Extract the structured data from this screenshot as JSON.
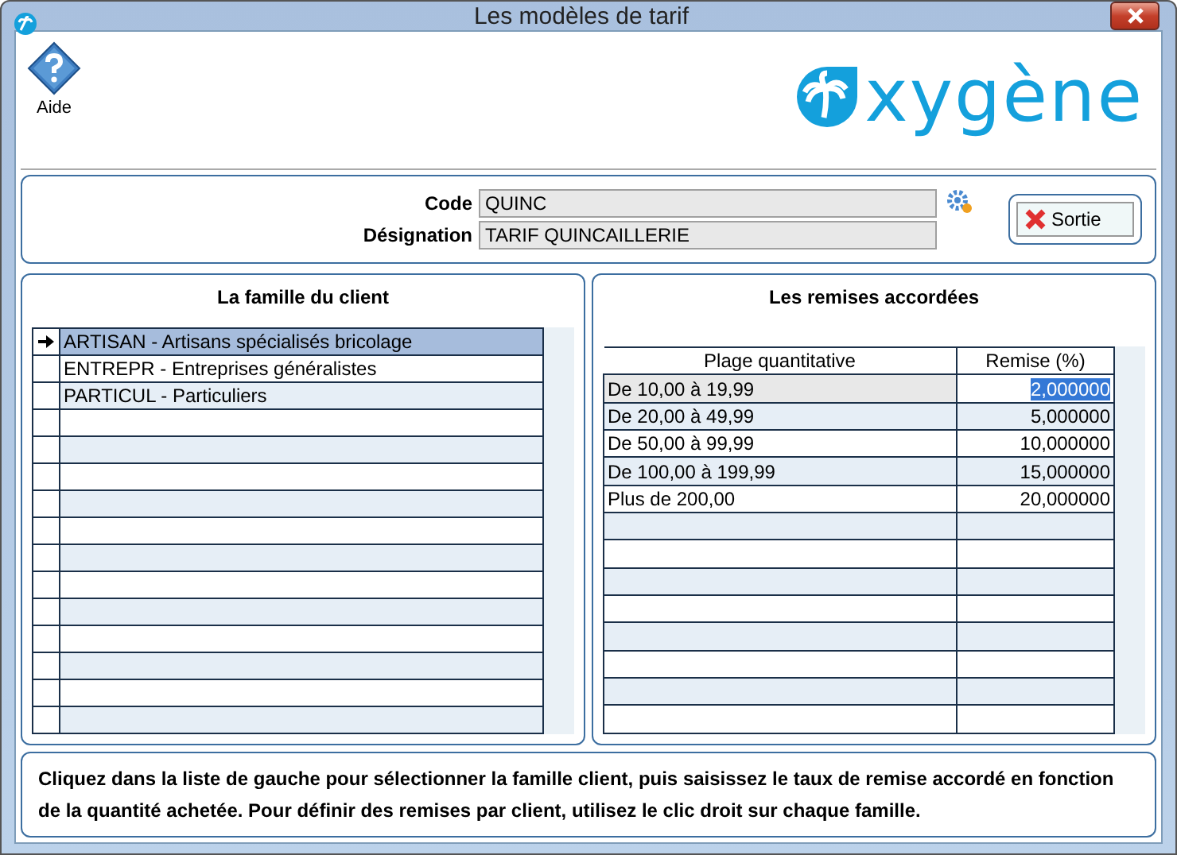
{
  "window": {
    "title": "Les modèles de tarif"
  },
  "toolbar": {
    "help_label": "Aide",
    "logo_text": "xygène"
  },
  "form": {
    "code_label": "Code",
    "code_value": "QUINC",
    "designation_label": "Désignation",
    "designation_value": "TARIF QUINCAILLERIE",
    "exit_button": "Sortie"
  },
  "families": {
    "title": "La famille du client",
    "rows": [
      {
        "text": "ARTISAN - Artisans spécialisés bricolage",
        "selected": true
      },
      {
        "text": "ENTREPR - Entreprises généralistes",
        "selected": false
      },
      {
        "text": "PARTICUL - Particuliers",
        "selected": false
      }
    ]
  },
  "discounts": {
    "title": "Les remises accordées",
    "columns": [
      "Plage quantitative",
      "Remise (%)"
    ],
    "rows": [
      {
        "range": "De 10,00 à 19,99",
        "discount": "2,000000",
        "selected": true
      },
      {
        "range": "De 20,00 à 49,99",
        "discount": "5,000000",
        "selected": false
      },
      {
        "range": "De 50,00 à 99,99",
        "discount": "10,000000",
        "selected": false
      },
      {
        "range": "De 100,00 à 199,99",
        "discount": "15,000000",
        "selected": false
      },
      {
        "range": "Plus de 200,00",
        "discount": "20,000000",
        "selected": false
      }
    ]
  },
  "help_text": "Cliquez dans la liste de gauche pour sélectionner la famille client, puis saisissez le taux de remise accordé en fonction de la quantité achetée. Pour définir des remises par client, utilisez le clic droit sur chaque famille."
}
